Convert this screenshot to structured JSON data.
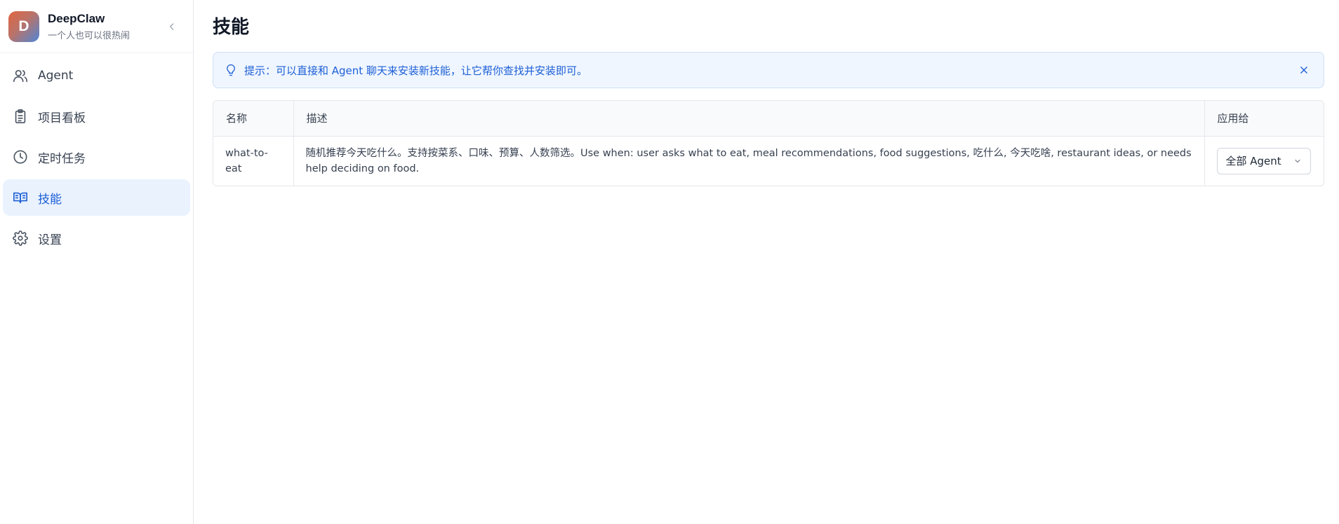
{
  "brand": {
    "logo_letter": "D",
    "name": "DeepClaw",
    "subtitle": "一个人也可以很热闹"
  },
  "sidebar": {
    "items": [
      {
        "label": "Agent",
        "icon": "users-icon",
        "active": false
      },
      {
        "label": "项目看板",
        "icon": "clipboard-icon",
        "active": false
      },
      {
        "label": "定时任务",
        "icon": "clock-icon",
        "active": false
      },
      {
        "label": "技能",
        "icon": "book-open-icon",
        "active": true
      },
      {
        "label": "设置",
        "icon": "gear-icon",
        "active": false
      }
    ]
  },
  "main": {
    "title": "技能",
    "tip": {
      "icon": "lightbulb-icon",
      "text": "提示：可以直接和 Agent 聊天来安装新技能，让它帮你查找并安装即可。"
    },
    "table": {
      "headers": [
        "名称",
        "描述",
        "应用给"
      ],
      "rows": [
        {
          "name": "what-to-eat",
          "description": "随机推荐今天吃什么。支持按菜系、口味、预算、人数筛选。Use when: user asks what to eat, meal recommendations, food suggestions, 吃什么, 今天吃啥, restaurant ideas, or needs help deciding on food.",
          "apply_to": "全部 Agent"
        }
      ]
    }
  },
  "colors": {
    "accent": "#1d5fd6",
    "active_bg": "#eaf2fe",
    "tip_bg": "#eff6ff"
  }
}
